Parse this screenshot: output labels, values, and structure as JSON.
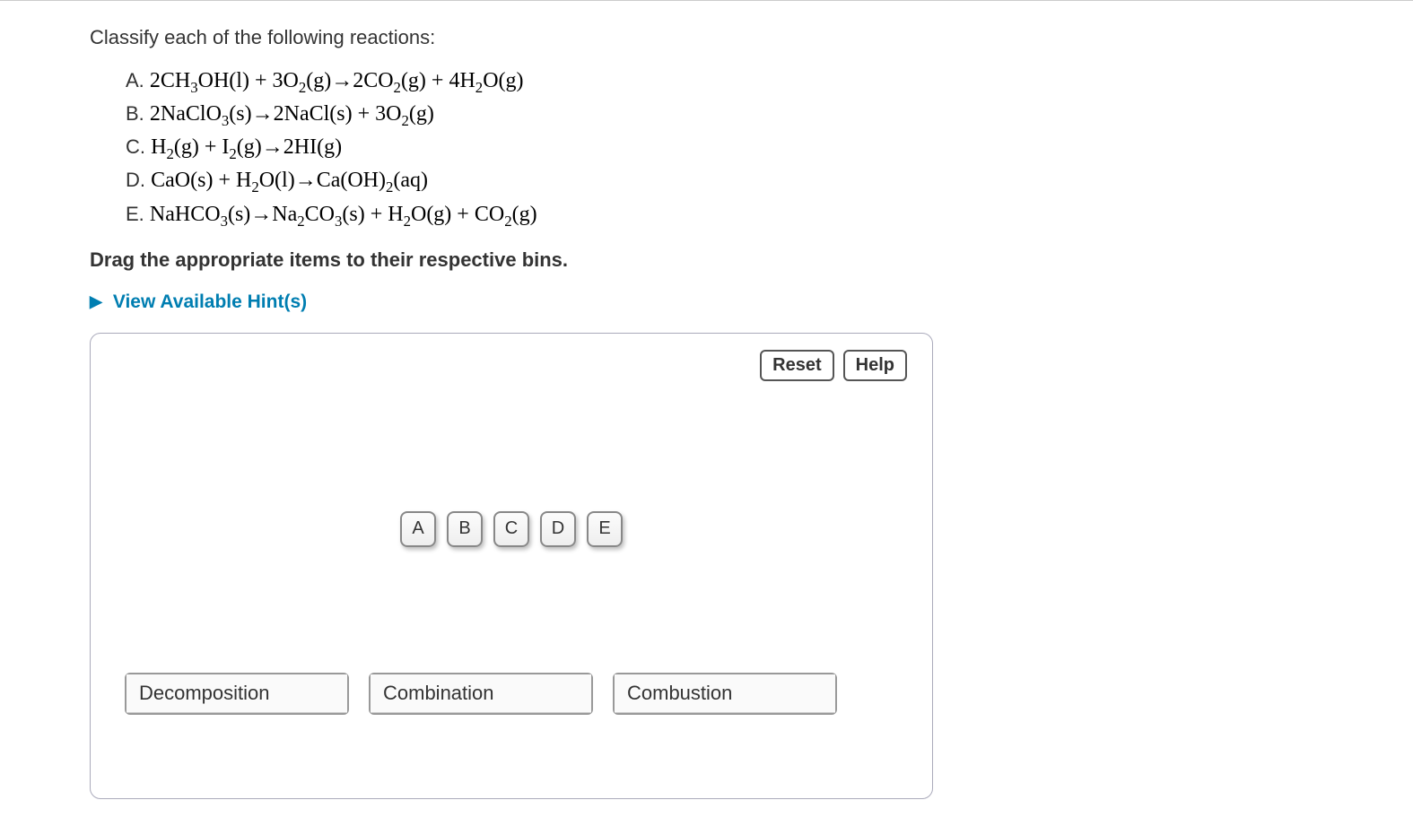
{
  "question": "Classify each of the following reactions:",
  "equations": {
    "a_label": "A. ",
    "a_html": "2CH<sub>3</sub>OH(l) + 3O<sub>2</sub>(g)→2CO<sub>2</sub>(g) + 4H<sub>2</sub>O(g)",
    "b_label": "B. ",
    "b_html": "2NaClO<sub>3</sub>(s)→2NaCl(s) + 3O<sub>2</sub>(g)",
    "c_label": "C. ",
    "c_html": "H<sub>2</sub>(g) + I<sub>2</sub>(g)→2HI(g)",
    "d_label": "D. ",
    "d_html": "CaO(s) + H<sub>2</sub>O(l)→Ca(OH)<sub>2</sub>(aq)",
    "e_label": "E. ",
    "e_html": "NaHCO<sub>3</sub>(s)→Na<sub>2</sub>CO<sub>3</sub>(s) + H<sub>2</sub>O(g) + CO<sub>2</sub>(g)"
  },
  "instruction": "Drag the appropriate items to their respective bins.",
  "hints_label": "View Available Hint(s)",
  "buttons": {
    "reset": "Reset",
    "help": "Help"
  },
  "items": {
    "a": "A",
    "b": "B",
    "c": "C",
    "d": "D",
    "e": "E"
  },
  "bins": {
    "decomposition": "Decomposition",
    "combination": "Combination",
    "combustion": "Combustion"
  }
}
